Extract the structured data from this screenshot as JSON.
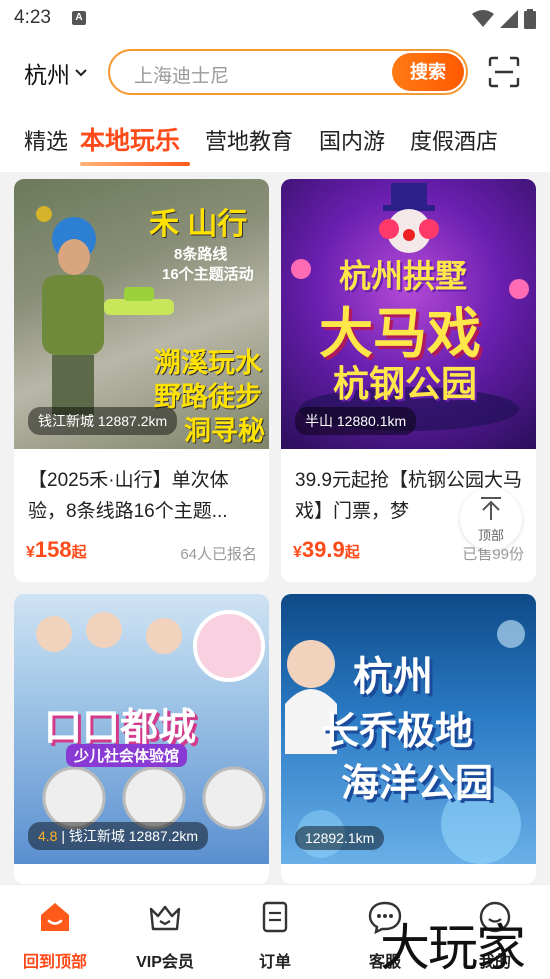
{
  "status": {
    "time": "4:23",
    "app_icon_letter": "A"
  },
  "header": {
    "city": "杭州",
    "search_placeholder": "上海迪士尼",
    "search_button": "搜索"
  },
  "tabs": [
    {
      "label": "精选"
    },
    {
      "label": "本地玩乐"
    },
    {
      "label": "营地教育"
    },
    {
      "label": "国内游"
    },
    {
      "label": "度假酒店"
    }
  ],
  "cards": [
    {
      "image_text": [
        "禾 山行",
        "8条路线",
        "16个主题活动",
        "溯溪玩水",
        "野路徒步",
        "洞寻秘"
      ],
      "distance": "钱江新城 12887.2km",
      "title": "【2025禾·山行】单次体验，8条线路16个主题...",
      "price_currency": "¥",
      "price": "158",
      "price_suffix": "起",
      "meta": "64人已报名"
    },
    {
      "image_text": [
        "杭州拱墅",
        "大马戏",
        "杭钢公园"
      ],
      "distance": "半山 12880.1km",
      "title": "39.9元起抢【杭钢公园大马戏】门票，梦",
      "price_currency": "¥",
      "price": "39.9",
      "price_suffix": "起",
      "meta": "已售99份"
    },
    {
      "image_text": [
        "口口都城",
        "少儿社会体验馆"
      ],
      "rating": "4.8",
      "distance": " | 钱江新城 12887.2km"
    },
    {
      "image_text": [
        "杭州",
        "长乔极地",
        "海洋公园"
      ],
      "distance": "12892.1km"
    }
  ],
  "back_to_top": "顶部",
  "bottom_nav": [
    {
      "label": "回到顶部",
      "icon": "home-icon"
    },
    {
      "label": "VIP会员",
      "icon": "vip-crown-icon"
    },
    {
      "label": "订单",
      "icon": "order-icon"
    },
    {
      "label": "客服",
      "icon": "chat-icon"
    },
    {
      "label": "我的",
      "icon": "user-icon"
    }
  ],
  "watermark": "大玩家",
  "colors": {
    "accent": "#ff4a1a",
    "search_border": "#f59a32"
  }
}
